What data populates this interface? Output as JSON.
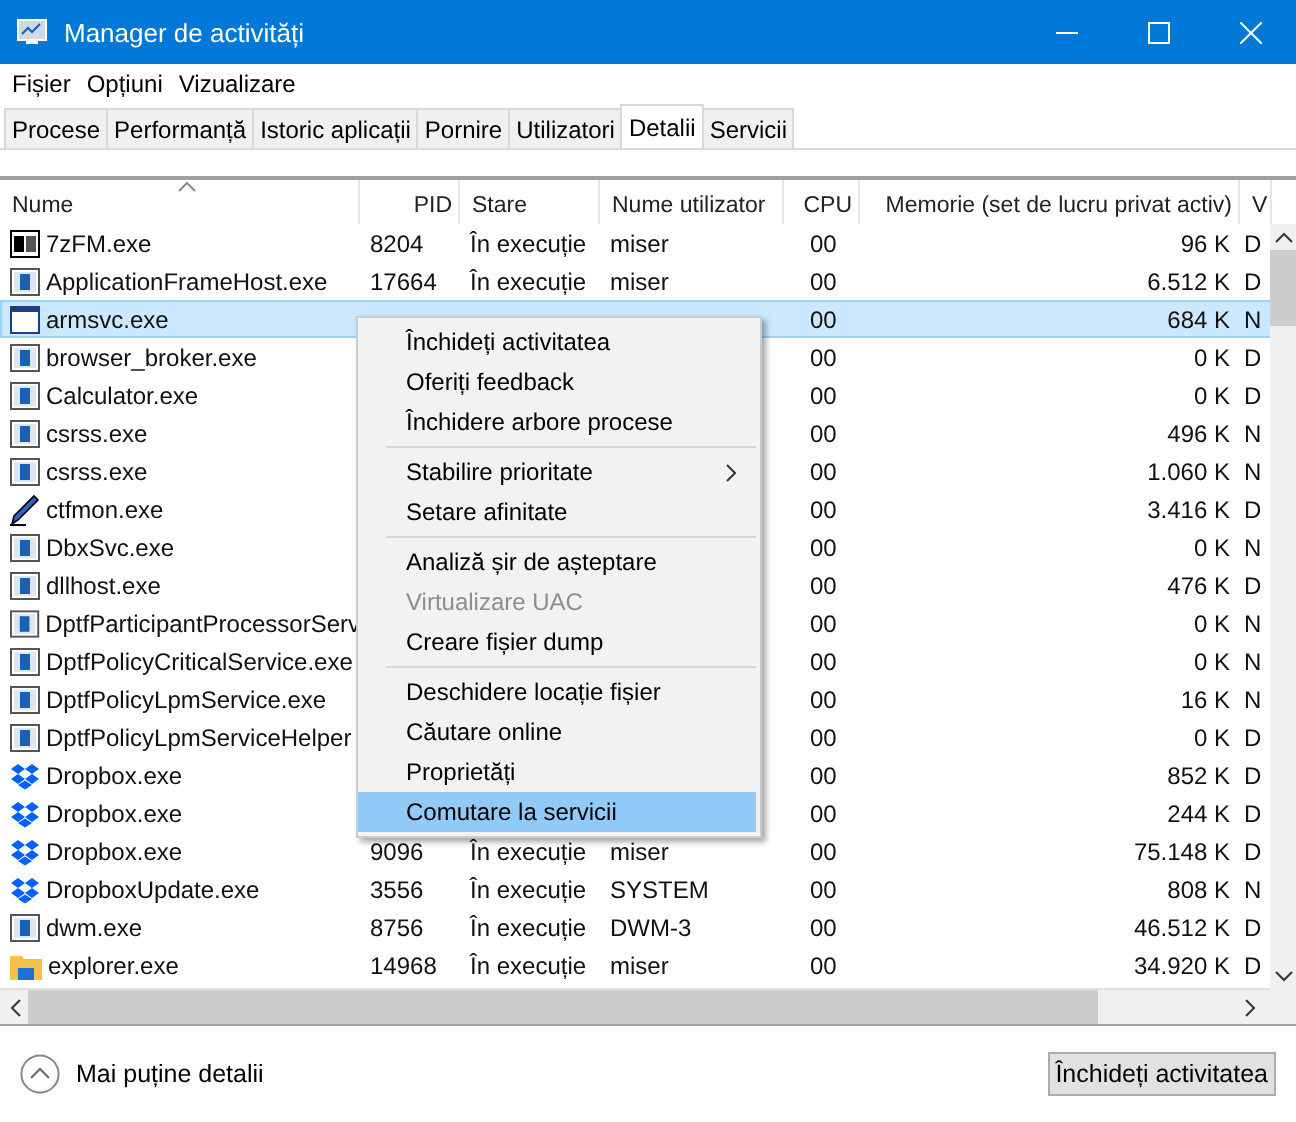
{
  "window": {
    "title": "Manager de activități"
  },
  "menu": [
    "Fișier",
    "Opțiuni",
    "Vizualizare"
  ],
  "tabs": [
    {
      "label": "Procese",
      "selected": false
    },
    {
      "label": "Performanță",
      "selected": false
    },
    {
      "label": "Istoric aplicații",
      "selected": false
    },
    {
      "label": "Pornire",
      "selected": false
    },
    {
      "label": "Utilizatori",
      "selected": false
    },
    {
      "label": "Detalii",
      "selected": true
    },
    {
      "label": "Servicii",
      "selected": false
    }
  ],
  "table": {
    "columns": [
      "Nume",
      "PID",
      "Stare",
      "Nume utilizator",
      "CPU",
      "Memorie (set de lucru privat activ)",
      "V"
    ],
    "rows": [
      {
        "kind": "archive",
        "name": "7zFM.exe",
        "pid": "8204",
        "status": "În execuție",
        "user": "miser",
        "cpu": "00",
        "memory": "96 K",
        "col7": "D",
        "selected": false
      },
      {
        "kind": "app",
        "name": "ApplicationFrameHost.exe",
        "pid": "17664",
        "status": "În execuție",
        "user": "miser",
        "cpu": "00",
        "memory": "6.512 K",
        "col7": "D",
        "selected": false
      },
      {
        "kind": "blank",
        "name": "armsvc.exe",
        "cpu": "00",
        "memory": "684 K",
        "col7": "N",
        "selected": true
      },
      {
        "kind": "app",
        "name": "browser_broker.exe",
        "cpu": "00",
        "memory": "0 K",
        "col7": "D",
        "selected": false
      },
      {
        "kind": "app",
        "name": "Calculator.exe",
        "cpu": "00",
        "memory": "0 K",
        "col7": "D",
        "selected": false
      },
      {
        "kind": "app",
        "name": "csrss.exe",
        "cpu": "00",
        "memory": "496 K",
        "col7": "N",
        "selected": false
      },
      {
        "kind": "app",
        "name": "csrss.exe",
        "cpu": "00",
        "memory": "1.060 K",
        "col7": "N",
        "selected": false
      },
      {
        "kind": "pen",
        "name": "ctfmon.exe",
        "cpu": "00",
        "memory": "3.416 K",
        "col7": "D",
        "selected": false
      },
      {
        "kind": "app",
        "name": "DbxSvc.exe",
        "cpu": "00",
        "memory": "0 K",
        "col7": "N",
        "selected": false
      },
      {
        "kind": "app",
        "name": "dllhost.exe",
        "cpu": "00",
        "memory": "476 K",
        "col7": "D",
        "selected": false
      },
      {
        "kind": "app",
        "name": "DptfParticipantProcessorServ",
        "cpu": "00",
        "memory": "0 K",
        "col7": "N",
        "selected": false
      },
      {
        "kind": "app",
        "name": "DptfPolicyCriticalService.exe",
        "cpu": "00",
        "memory": "0 K",
        "col7": "N",
        "selected": false
      },
      {
        "kind": "app",
        "name": "DptfPolicyLpmService.exe",
        "cpu": "00",
        "memory": "16 K",
        "col7": "N",
        "selected": false
      },
      {
        "kind": "app",
        "name": "DptfPolicyLpmServiceHelper",
        "cpu": "00",
        "memory": "0 K",
        "col7": "D",
        "selected": false
      },
      {
        "kind": "dropbox",
        "name": "Dropbox.exe",
        "cpu": "00",
        "memory": "852 K",
        "col7": "D",
        "selected": false
      },
      {
        "kind": "dropbox",
        "name": "Dropbox.exe",
        "cpu": "00",
        "memory": "244 K",
        "col7": "D",
        "selected": false
      },
      {
        "kind": "dropbox",
        "name": "Dropbox.exe",
        "pid": "9096",
        "status": "În execuție",
        "user": "miser",
        "cpu": "00",
        "memory": "75.148 K",
        "col7": "D",
        "selected": false
      },
      {
        "kind": "dropbox",
        "name": "DropboxUpdate.exe",
        "pid": "3556",
        "status": "În execuție",
        "user": "SYSTEM",
        "cpu": "00",
        "memory": "808 K",
        "col7": "N",
        "selected": false
      },
      {
        "kind": "app",
        "name": "dwm.exe",
        "pid": "8756",
        "status": "În execuție",
        "user": "DWM-3",
        "cpu": "00",
        "memory": "46.512 K",
        "col7": "D",
        "selected": false
      },
      {
        "kind": "folder",
        "name": "explorer.exe",
        "pid": "14968",
        "status": "În execuție",
        "user": "miser",
        "cpu": "00",
        "memory": "34.920 K",
        "col7": "D",
        "selected": false
      }
    ]
  },
  "context_menu": {
    "groups": [
      [
        {
          "label": "Închideți activitatea",
          "disabled": false,
          "selected": false
        },
        {
          "label": "Oferiți feedback",
          "disabled": false,
          "selected": false
        },
        {
          "label": "Închidere arbore procese",
          "disabled": false,
          "selected": false
        }
      ],
      [
        {
          "label": "Stabilire prioritate",
          "disabled": false,
          "selected": false,
          "submenu": true
        },
        {
          "label": "Setare afinitate",
          "disabled": false,
          "selected": false
        }
      ],
      [
        {
          "label": "Analiză șir de așteptare",
          "disabled": false,
          "selected": false
        },
        {
          "label": "Virtualizare UAC",
          "disabled": true,
          "selected": false
        },
        {
          "label": "Creare fișier dump",
          "disabled": false,
          "selected": false
        }
      ],
      [
        {
          "label": "Deschidere locație fișier",
          "disabled": false,
          "selected": false
        },
        {
          "label": "Căutare online",
          "disabled": false,
          "selected": false
        },
        {
          "label": "Proprietăți",
          "disabled": false,
          "selected": false
        },
        {
          "label": "Comutare la servicii",
          "disabled": false,
          "selected": true
        }
      ]
    ]
  },
  "footer": {
    "toggle_label": "Mai puține detalii",
    "button": "Închideți activitatea"
  }
}
